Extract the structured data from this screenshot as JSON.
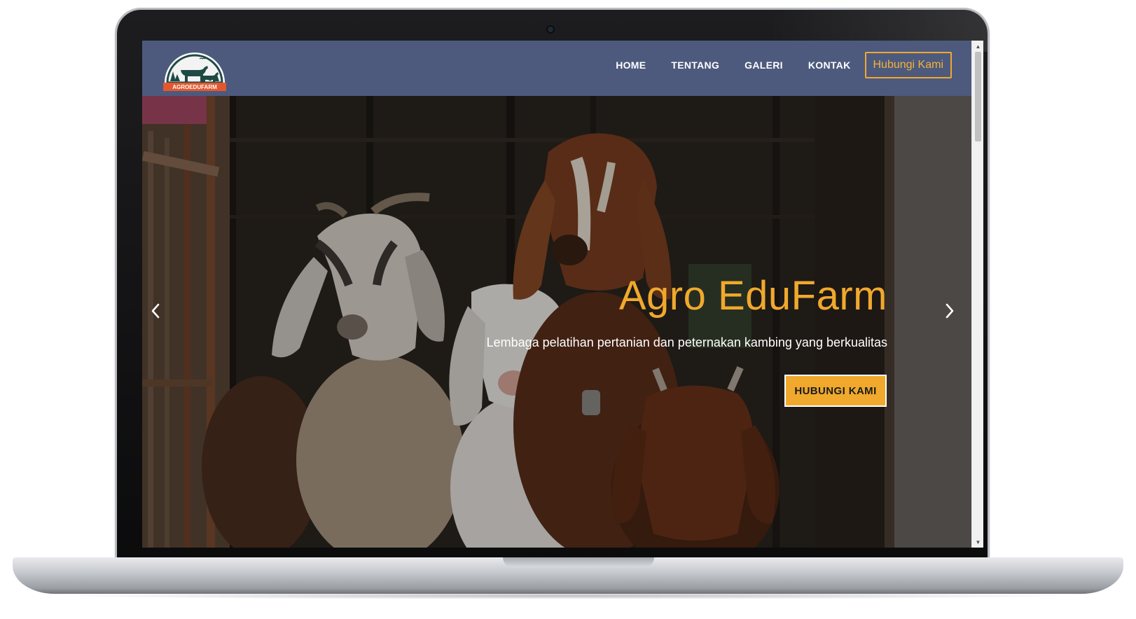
{
  "logo": {
    "text": "AGROEDUFARM"
  },
  "nav": {
    "items": [
      {
        "label": "HOME"
      },
      {
        "label": "TENTANG"
      },
      {
        "label": "GALERI"
      },
      {
        "label": "KONTAK"
      }
    ],
    "cta_label": "Hubungi Kami"
  },
  "hero": {
    "title": "Agro EduFarm",
    "subtitle": "Lembaga pelatihan pertanian dan peternakan kambing yang berkualitas",
    "cta_label": "HUBUNGI KAMI"
  },
  "colors": {
    "navbar": "#4d5a7e",
    "accent": "#f0a92d",
    "logo_badge": "#e4572e"
  },
  "icons": {
    "prev": "chevron-left-icon",
    "next": "chevron-right-icon",
    "scroll_up": "triangle-up-icon",
    "scroll_down": "triangle-down-icon"
  }
}
